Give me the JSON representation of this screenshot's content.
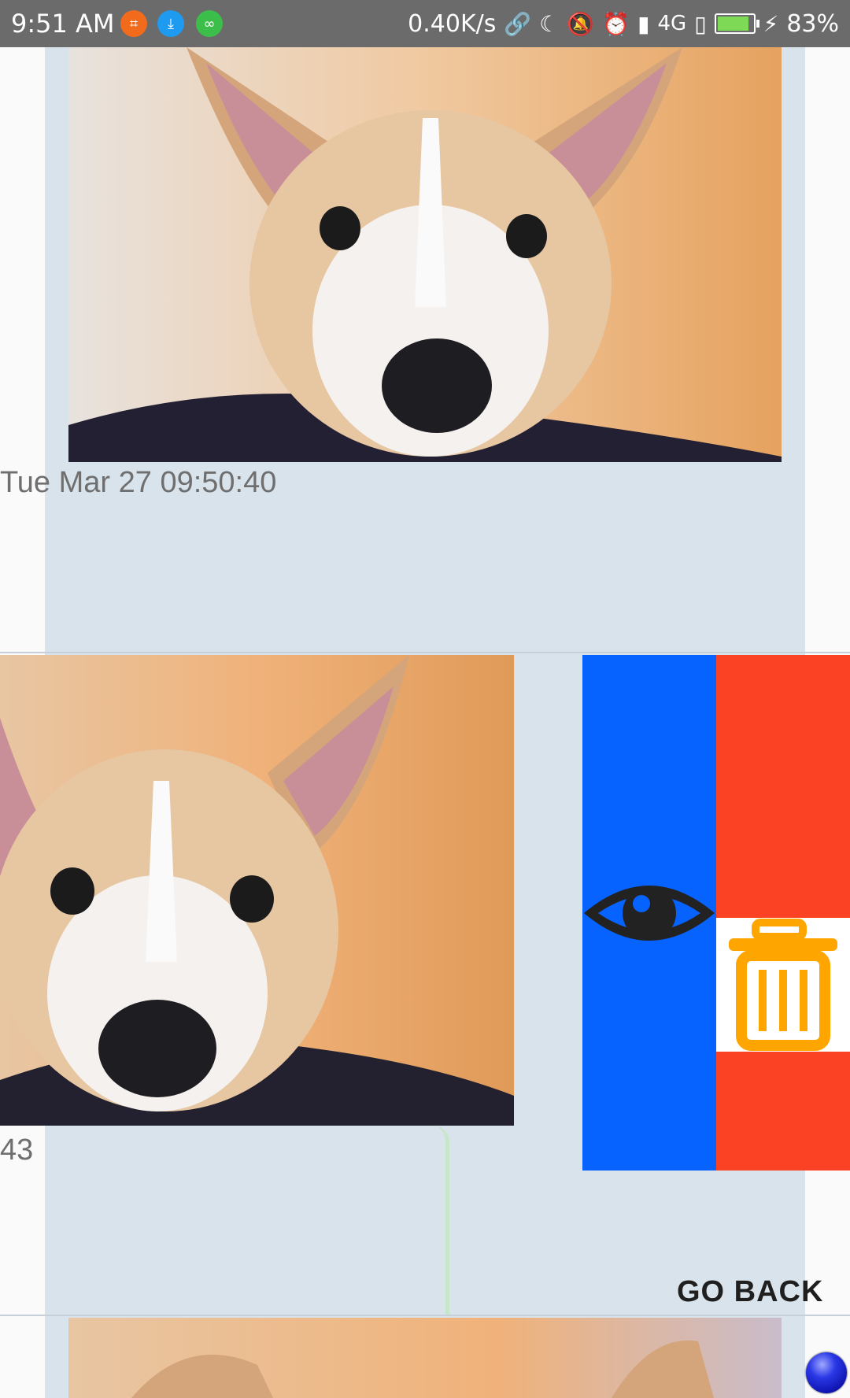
{
  "status_bar": {
    "time": "9:51 AM",
    "network_speed": "0.40K/s",
    "network_type": "4G",
    "battery": "83%",
    "app_icons": [
      "screenshot-app-icon",
      "download-icon",
      "link-app-icon"
    ],
    "icons": [
      "link-icon",
      "moon-icon",
      "bell-off-icon",
      "alarm-icon",
      "signal-icon",
      "signal-empty-icon",
      "battery-icon",
      "charging-icon"
    ]
  },
  "items": [
    {
      "timestamp": "Tue Mar 27 09:50:40"
    },
    {
      "timestamp_partial": "43"
    }
  ],
  "actions": {
    "view_icon": "eye-icon",
    "delete_icon": "trash-icon",
    "view_color": "#0763ff",
    "delete_color": "#fc4224"
  },
  "go_back_label": "GO BACK",
  "colors": {
    "status_bar": "#6b6b6b",
    "card_background": "#d9e3eb",
    "page_background": "#fafafa",
    "trash_icon": "#ffa500"
  }
}
